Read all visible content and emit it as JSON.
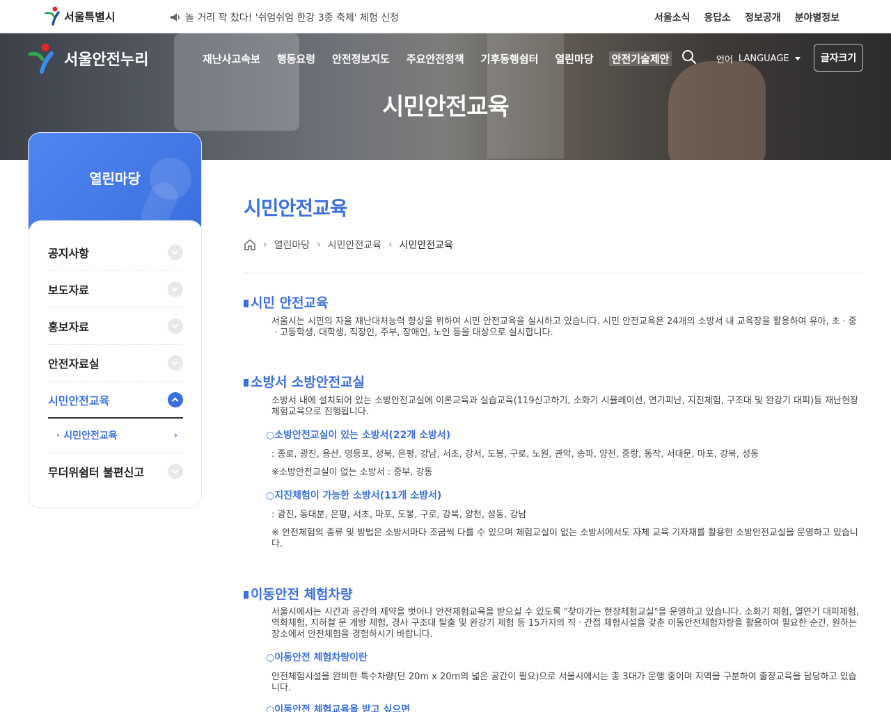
{
  "topbar": {
    "logo_text": "서울특별시",
    "notice": "놀 거리 꽉 찼다! '쉬엄쉬엄 한강 3종 축제' 체험 신청",
    "links": [
      "서울소식",
      "응답소",
      "정보공개",
      "분야별정보"
    ]
  },
  "header": {
    "brand": "서울안전누리",
    "nav": [
      "재난사고속보",
      "행동요령",
      "안전정보지도",
      "주요안전정책",
      "기후동행쉼터",
      "열린마당",
      "안전기술제안"
    ],
    "lang_label": "언어",
    "lang_value": "LANGUAGE",
    "font_size_label": "글자크기",
    "hero_title": "시민안전교육"
  },
  "sidebar": {
    "title": "열린마당",
    "items": [
      "공지사항",
      "보도자료",
      "홍보자료",
      "안전자료실",
      "시민안전교육"
    ],
    "sub_item": "· 시민안전교육",
    "last_item": "무더위쉼터 불편신고"
  },
  "content": {
    "page_title": "시민안전교육",
    "breadcrumb": [
      "열린마당",
      "시민안전교육",
      "시민안전교육"
    ],
    "sections": [
      {
        "title": "시민 안전교육",
        "paras": [
          "서울시는 시민의 자율 재난대처능력 향상을 위하여 시민 안전교육을 실시하고 있습니다. 시민 안전교육은 24개의 소방서 내 교육장을 활용하여 유아, 초ㆍ중ㆍ고등학생, 대학생, 직장인, 주부, 장애인, 노인 등을 대상으로 실시합니다."
        ]
      },
      {
        "title": "소방서 소방안전교실",
        "paras": [
          "소방서 내에 설치되어 있는 소방안전교실에 이론교육과 실습교육(119신고하기, 소화기 시뮬레이션, 연기피난, 지진체험, 구조대 및 완강기 대피)등 재난현장 체험교육으로 진행됩니다."
        ],
        "sub1": "○소방안전교실이 있는 소방서(22개 소방서)",
        "sub1_list": ": 종로, 광진, 용산, 영등포, 성북, 은평, 강남, 서초, 강서, 도봉, 구로, 노원, 관악, 송파, 양천, 중랑, 동작, 서대문, 마포, 강북, 성동",
        "sub1_note": "※소방안전교실이 없는 소방서 : 중부, 강동",
        "sub2": "○지진체험이 가능한 소방서(11개 소방서)",
        "sub2_list": ": 광진, 동대분, 은평, 서초, 마포, 도봉, 구로, 강북, 양천, 성동, 강남",
        "sub2_note": "※ 안전체험의 종류 및 방법은 소방서마다 조금씩 다를 수 있으며 체험교실이 없는 소방서에서도 자체 교육 기자재를 활용한 소방안전교실을 운영하고 있습니다."
      },
      {
        "title": "이동안전 체험차량",
        "paras": [
          "서울시에서는 시간과 공간의 제약을 벗어나 안전체험교육을 받으실 수 있도록 \"찾아가는 현장체험교실\"을 운영하고 있습니다. 소화기 체험, 열연기 대피체험, 역화체험, 지하철 문 개방 체험, 경사 구조대 탈출 및 완강기 체험 등 15가지의 직ㆍ간접 체험시설을 갖춘 이동안전체험차량을 활용하여 필요한 순간, 원하는 장소에서 안전체험을 경험하시기 바랍니다."
        ],
        "sub1": "○이동안전 체험차량이란",
        "sub1_text": "안전체험시설을 완비한 특수차량(단 20m x 20m의 넓은 공간이 필요)으로 서울시에서는 총 3대가 운행 중이며 지역을 구분하여 출장교육을 담당하고 있습니다.",
        "sub2": "○이동안전 체험교육을 받고 싶으면"
      }
    ]
  },
  "colors": {
    "accent": "#3b6fe0",
    "seoul_red": "#e2262b",
    "seoul_green": "#2fa84f",
    "seoul_blue": "#1d4ea3"
  }
}
